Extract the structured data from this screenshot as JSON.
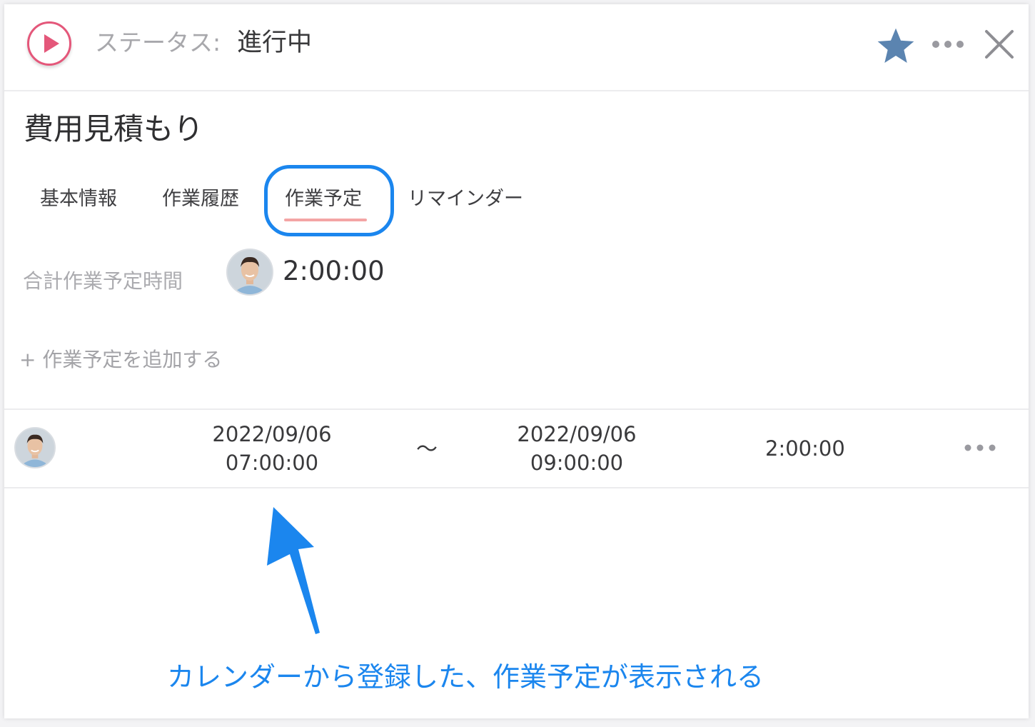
{
  "header": {
    "status_label": "ステータス:",
    "status_value": "進行中",
    "play_icon": "play-icon",
    "favorite_icon": "star-icon",
    "more_icon": "more-horizontal-icon",
    "close_icon": "close-icon",
    "accent_color": "#e4577a",
    "star_color": "#5b84b0"
  },
  "task": {
    "title": "費用見積もり"
  },
  "tabs": [
    {
      "label": "基本情報",
      "active": false
    },
    {
      "label": "作業履歴",
      "active": false
    },
    {
      "label": "作業予定",
      "active": true
    },
    {
      "label": "リマインダー",
      "active": false
    }
  ],
  "summary": {
    "total_label": "合計作業予定時間",
    "total_value": "2:00:00"
  },
  "add_schedule_label": "+ 作業予定を追加する",
  "schedules": [
    {
      "start_date": "2022/09/06",
      "start_time": "07:00:00",
      "separator": "〜",
      "end_date": "2022/09/06",
      "end_time": "09:00:00",
      "duration": "2:00:00"
    }
  ],
  "annotation": {
    "text": "カレンダーから登録した、作業予定が表示される",
    "color": "#1b86ee"
  }
}
